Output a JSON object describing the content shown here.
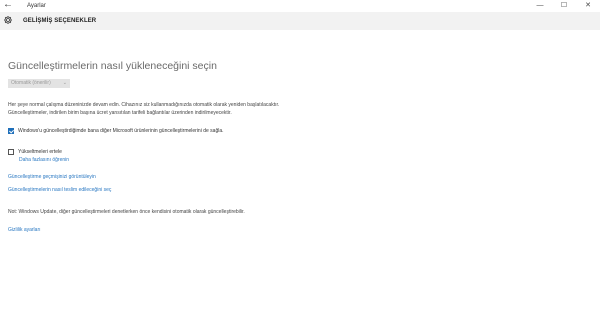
{
  "window": {
    "title": "Ayarlar",
    "controls": {
      "minimize": "—",
      "maximize": "☐",
      "close": "✕"
    }
  },
  "header": {
    "title": "GELİŞMİŞ SEÇENEKLER",
    "icon": "gear-icon"
  },
  "main": {
    "heading": "Güncelleştirmelerin nasıl yükleneceğini seçin",
    "install_mode": {
      "selected": "Otomatik (önerilir)",
      "disabled": true
    },
    "description": [
      "Her şeye normal çalışma düzeninizde devam edin. Cihazınız siz kullanmadığınızda otomatik olarak yeniden başlatılacaktır.",
      "Güncelleştirmeler, indirilen birim başına ücret yansıtılan tarifeli bağlantılar üzerinden indirilmeyecektir."
    ],
    "microsoft_updates": {
      "label": "Windows'u güncelleştirdiğimde bana diğer Microsoft ürünlerinin güncelleştirmelerini de sağla.",
      "checked": true
    },
    "defer_upgrades": {
      "label": "Yükseltmeleri ertele",
      "checked": false,
      "learn_more": "Daha fazlasını öğrenin"
    },
    "links": {
      "history": "Güncelleştirme geçmişinizi görüntüleyin",
      "delivery": "Güncelleştirmelerin nasıl teslim edileceğini seç"
    },
    "note": "Not: Windows Update, diğer güncelleştirmeleri denetlerken önce kendisini otomatik olarak güncelleştirebilir.",
    "privacy_link": "Gizlilik ayarları"
  },
  "colors": {
    "accent": "#2a78c2",
    "header_bg": "#f2f2f2",
    "checkbox": "#1e6fba"
  }
}
